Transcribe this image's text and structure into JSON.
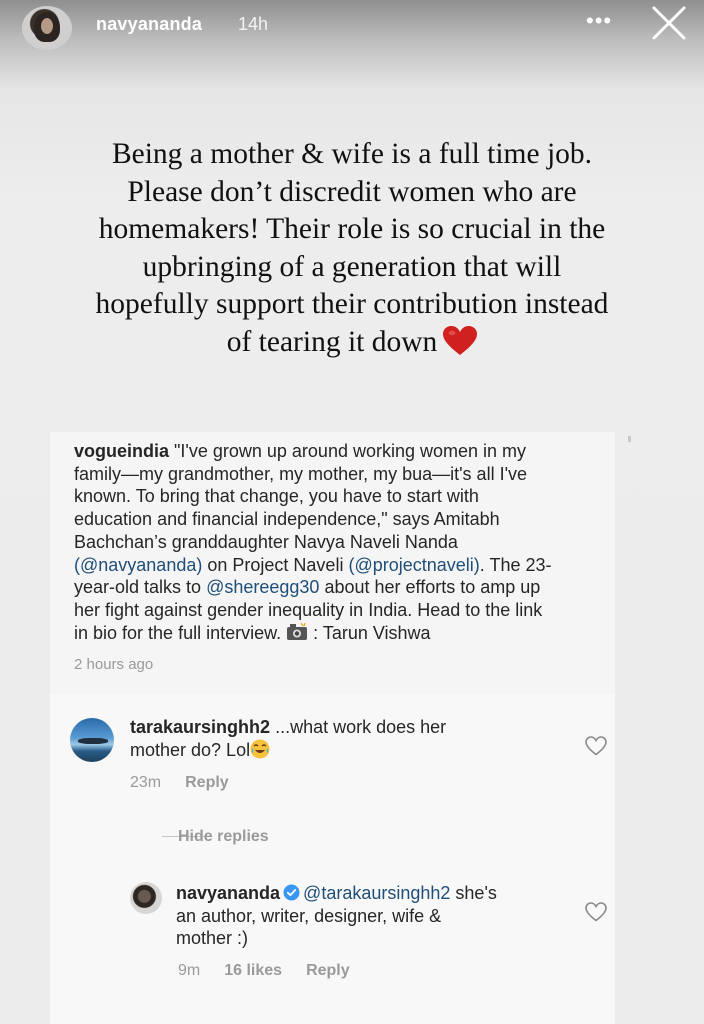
{
  "header": {
    "username": "navyananda",
    "time": "14h",
    "more_icon": "more-dots-icon",
    "close_icon": "close-icon"
  },
  "story": {
    "lines": [
      "Being a mother & wife is a full time job.",
      "Please don’t discredit women who are",
      "homemakers! Their role is so crucial in the",
      "upbringing of a generation that will",
      "hopefully support their contribution instead",
      "of tearing it down"
    ],
    "heart_color": "#d0201f"
  },
  "post": {
    "author": "vogueindia",
    "caption_lines": [
      "\"I've grown up around working women in my",
      "family—my grandmother, my mother, my bua—it's all I've",
      "known. To bring that change, you have to start with",
      "education and financial independence,\" says Amitabh",
      "Bachchan’s granddaughter Navya Naveli Nanda",
      "on Project Naveli",
      ". The 23-",
      "year-old talks to",
      "about her efforts to amp up",
      "her fight against gender inequality in India. Head to the link",
      "in bio for the full interview.",
      ": Tarun Vishwa"
    ],
    "mentions": {
      "navyananda": "(@navyananda)",
      "projectnaveli": "(@projectnaveli)",
      "shereegg30": "@shereegg30"
    },
    "time": "2 hours ago"
  },
  "comments": [
    {
      "username": "tarakaursinghh2",
      "text_lines": [
        "...what work does her",
        "mother do? Lol"
      ],
      "time": "23m",
      "reply_label": "Reply"
    }
  ],
  "hide_replies_label": "Hide replies",
  "reply": {
    "username": "navyananda",
    "mention": "@tarakaursinghh2",
    "text_lines": [
      "she's",
      "an author, writer, designer, wife &",
      "mother :)"
    ],
    "time": "9m",
    "likes": "16 likes",
    "reply_label": "Reply"
  },
  "colors": {
    "text": "#262626",
    "mention": "#1f4e79",
    "muted": "#9a9a9a",
    "verified": "#3897f0"
  }
}
